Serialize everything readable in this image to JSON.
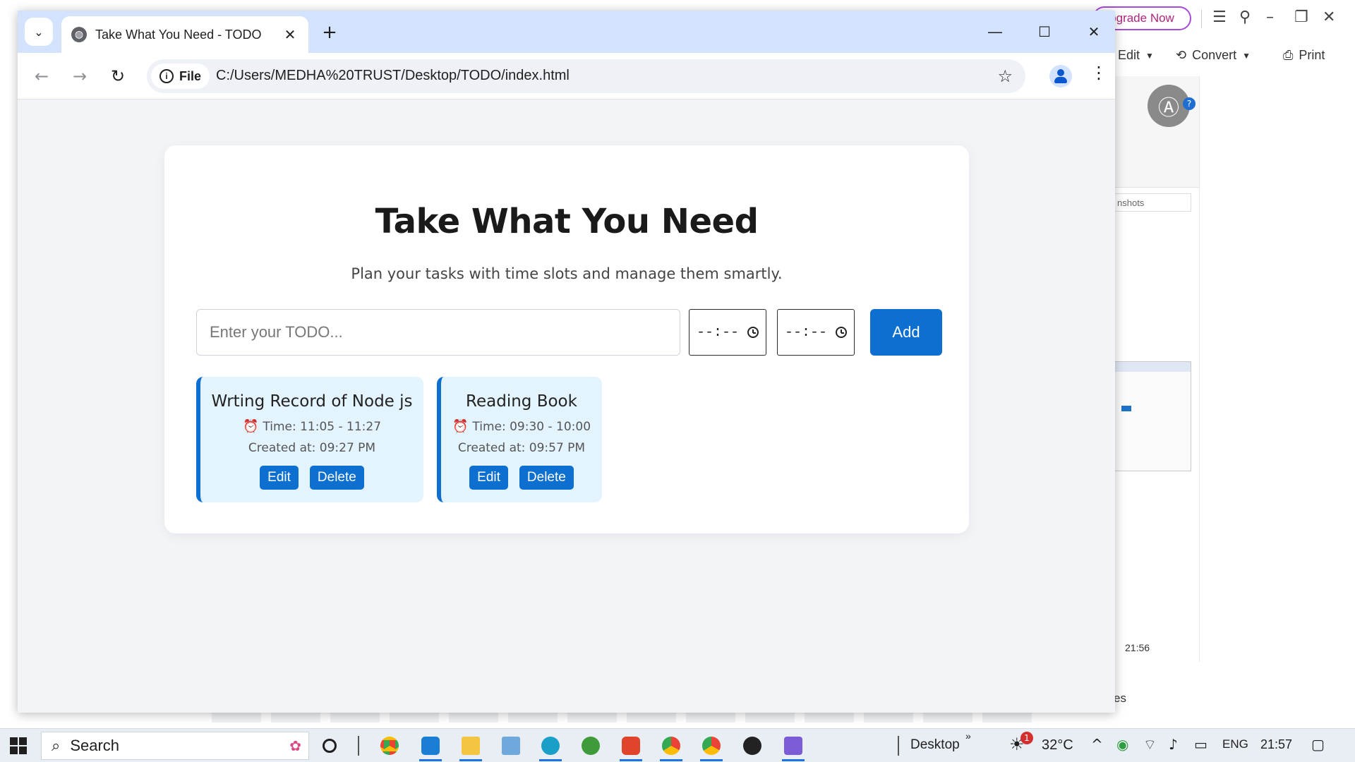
{
  "background_app": {
    "upgrade_label": "pgrade Now",
    "edit_label": "Edit",
    "convert_label": "Convert",
    "print_label": "Print",
    "search_fragment": "nshots",
    "clock_text": "21:56",
    "footer_fragment": "es"
  },
  "browser": {
    "tab_title": "Take What You Need - TODO",
    "site_chip_label": "File",
    "url": "C:/Users/MEDHA%20TRUST/Desktop/TODO/index.html"
  },
  "page": {
    "title": "Take What You Need",
    "subtitle": "Plan your tasks with time slots and manage them smartly.",
    "todo_input": {
      "value": "",
      "placeholder": "Enter your TODO..."
    },
    "start_time_display": "--:--",
    "end_time_display": "--:--",
    "add_label": "Add",
    "todos": [
      {
        "title": "Wrting Record of Node js",
        "time": "Time: 11:05 - 11:27",
        "created": "Created at: 09:27 PM",
        "edit_label": "Edit",
        "delete_label": "Delete"
      },
      {
        "title": "Reading Book",
        "time": "Time: 09:30 - 10:00",
        "created": "Created at: 09:57 PM",
        "edit_label": "Edit",
        "delete_label": "Delete"
      }
    ],
    "accent_color": "#0d6fd0",
    "card_background": "#e3f4ff"
  },
  "taskbar": {
    "search_label": "Search",
    "desktop_label": "Desktop",
    "weather": "32°C",
    "notification_count": "1",
    "language": "ENG",
    "clock": "21:57",
    "pinned_apps": [
      "chrome-icon",
      "vscode-icon",
      "file-explorer-icon",
      "notepad-icon",
      "edge-icon",
      "app-icon",
      "wps-icon",
      "chrome-alt-icon",
      "chrome-icon",
      "media-player-icon",
      "app-icon"
    ]
  }
}
